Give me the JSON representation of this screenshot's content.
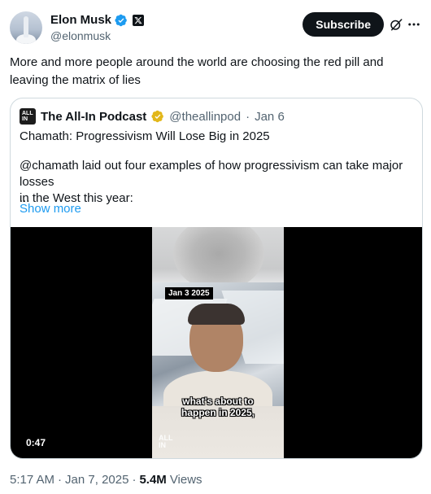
{
  "author": {
    "display_name": "Elon Musk",
    "handle": "@elonmusk"
  },
  "actions": {
    "subscribe_label": "Subscribe"
  },
  "tweet": {
    "text_line1": "More and more people around the world are choosing the red pill and",
    "text_line2": "leaving the matrix of lies"
  },
  "quote": {
    "logo_text_top": "ALL",
    "logo_text_bottom": "IN",
    "author_name": "The All-In Podcast",
    "author_handle": "@theallinpod",
    "separator": "·",
    "date": "Jan 6",
    "title": "Chamath: Progressivism Will Lose Big in 2025",
    "body_line1": "@chamath laid out four examples of how progressivism can take major losses",
    "body_line2": "in the West this year:",
    "ellipsis": "...",
    "show_more": "Show more",
    "video": {
      "date_tag": "Jan 3 2025",
      "caption_line1": "what's about to",
      "caption_line2": "happen in 2025,",
      "brand_top": "ALL",
      "brand_bottom": "IN",
      "duration": "0:47"
    }
  },
  "footer": {
    "time": "5:17 AM",
    "dot1": "·",
    "date": "Jan 7, 2025",
    "dot2": "·",
    "views_count": "5.4M",
    "views_label": "Views"
  },
  "colors": {
    "verified_blue": "#1d9bf0",
    "gold_badge": "#e2b719",
    "text_primary": "#0f1419",
    "text_secondary": "#536471"
  },
  "icons": {
    "verified": "verified-badge-icon",
    "x_affiliate": "x-logo-icon",
    "grok": "grok-icon",
    "more": "more-icon",
    "gold_verified": "gold-verified-badge-icon"
  }
}
